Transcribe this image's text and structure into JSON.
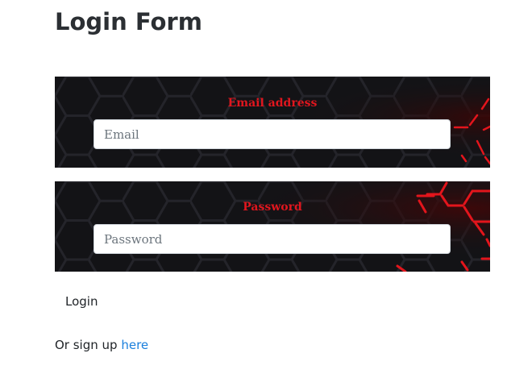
{
  "page": {
    "title": "Login Form"
  },
  "form": {
    "email": {
      "label": "Email address",
      "placeholder": "Email",
      "value": ""
    },
    "password": {
      "label": "Password",
      "placeholder": "Password",
      "value": ""
    },
    "submit_label": "Login"
  },
  "signup": {
    "prefix": "Or sign up ",
    "link_text": "here"
  },
  "colors": {
    "label_red": "#e0161e",
    "link_blue": "#1a7fdc",
    "panel_dark": "#131316",
    "hex_glow": "#e3151c"
  }
}
